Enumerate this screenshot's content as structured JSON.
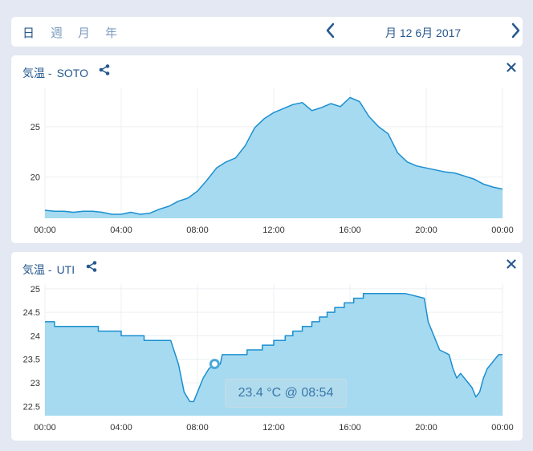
{
  "tabs": [
    {
      "label": "日",
      "active": true
    },
    {
      "label": "週",
      "active": false
    },
    {
      "label": "月",
      "active": false
    },
    {
      "label": "年",
      "active": false
    }
  ],
  "date_label": "月 12 6月 2017",
  "icons": {
    "prev": "chevron-left-icon",
    "next": "chevron-right-icon",
    "share": "share-icon",
    "close": "close-icon"
  },
  "colors": {
    "line": "#1b8fd0",
    "fill": "#a6daf0",
    "accent": "#27598f",
    "background": "#e3e8f2"
  },
  "cards": [
    {
      "title": "気温 -",
      "sensor": "SOTO"
    },
    {
      "title": "気温 -",
      "sensor": "UTI"
    }
  ],
  "tooltip": "23.4 °C @ 08:54",
  "chart_data": [
    {
      "type": "area",
      "title": "気温 - SOTO",
      "x_ticks": [
        "00:00",
        "04:00",
        "08:00",
        "12:00",
        "16:00",
        "20:00",
        "00:00"
      ],
      "y_ticks": [
        20,
        25
      ],
      "ylim": [
        15.9,
        28.9
      ],
      "xlim": [
        0,
        24
      ],
      "grid": true,
      "series": [
        {
          "x": [
            0,
            0.5,
            1,
            1.5,
            2,
            2.5,
            3,
            3.5,
            4,
            4.5,
            5,
            5.5,
            6,
            6.5,
            7,
            7.5,
            8,
            8.5,
            9,
            9.5,
            10,
            10.5,
            11,
            11.5,
            12,
            12.5,
            13,
            13.5,
            14,
            14.5,
            15,
            15.5,
            16,
            16.5,
            17,
            17.5,
            18,
            18.5,
            19,
            19.5,
            20,
            20.5,
            21,
            21.5,
            22,
            22.5,
            23,
            23.5,
            24
          ],
          "y": [
            16.7,
            16.6,
            16.6,
            16.5,
            16.6,
            16.6,
            16.5,
            16.3,
            16.3,
            16.5,
            16.3,
            16.4,
            16.8,
            17.1,
            17.6,
            17.9,
            18.6,
            19.7,
            20.9,
            21.5,
            21.9,
            23.1,
            24.9,
            25.8,
            26.4,
            26.8,
            27.2,
            27.4,
            26.6,
            26.9,
            27.3,
            27.0,
            27.9,
            27.5,
            26.0,
            25.0,
            24.3,
            22.4,
            21.5,
            21.1,
            20.9,
            20.7,
            20.5,
            20.4,
            20.1,
            19.8,
            19.3,
            19.0,
            18.8
          ]
        }
      ]
    },
    {
      "type": "area",
      "title": "気温 - UTI",
      "x_ticks": [
        "00:00",
        "04:00",
        "08:00",
        "12:00",
        "16:00",
        "20:00",
        "00:00"
      ],
      "y_ticks": [
        22.5,
        23,
        23.5,
        24,
        24.5,
        25
      ],
      "ylim": [
        22.3,
        25.1
      ],
      "xlim": [
        0,
        24
      ],
      "grid": true,
      "series": [
        {
          "x": [
            0,
            0.5,
            0.5,
            2.8,
            2.8,
            4.0,
            4.0,
            5.2,
            5.2,
            6.6,
            7.0,
            7.3,
            7.6,
            7.8,
            8.0,
            8.3,
            8.6,
            8.9,
            9.2,
            9.3,
            10.6,
            10.6,
            11.4,
            11.4,
            12.0,
            12.0,
            12.6,
            12.6,
            13.0,
            13.0,
            13.5,
            13.5,
            14.0,
            14.0,
            14.4,
            14.4,
            14.8,
            14.8,
            15.2,
            15.2,
            15.7,
            15.7,
            16.2,
            16.2,
            16.7,
            16.7,
            17.3,
            17.3,
            17.8,
            17.8,
            18.9,
            18.9,
            19.9,
            20.1,
            20.5,
            20.6,
            20.7,
            21.2,
            21.4,
            21.6,
            21.8,
            22.0,
            22.4,
            22.6,
            22.8,
            23.0,
            23.2,
            23.4,
            23.6,
            23.8,
            24.0
          ],
          "y": [
            24.3,
            24.3,
            24.2,
            24.2,
            24.1,
            24.1,
            24.0,
            24.0,
            23.9,
            23.9,
            23.4,
            22.8,
            22.6,
            22.6,
            22.8,
            23.1,
            23.3,
            23.4,
            23.4,
            23.6,
            23.6,
            23.7,
            23.7,
            23.8,
            23.8,
            23.9,
            23.9,
            24.0,
            24.0,
            24.1,
            24.1,
            24.2,
            24.2,
            24.3,
            24.3,
            24.4,
            24.4,
            24.5,
            24.5,
            24.6,
            24.6,
            24.7,
            24.7,
            24.8,
            24.8,
            24.9,
            24.9,
            24.9,
            24.9,
            24.9,
            24.9,
            24.9,
            24.8,
            24.3,
            23.9,
            23.8,
            23.7,
            23.6,
            23.3,
            23.1,
            23.2,
            23.1,
            22.9,
            22.7,
            22.8,
            23.1,
            23.3,
            23.4,
            23.5,
            23.6,
            23.6
          ]
        }
      ],
      "marker": {
        "x": 8.9,
        "y": 23.4
      }
    }
  ]
}
